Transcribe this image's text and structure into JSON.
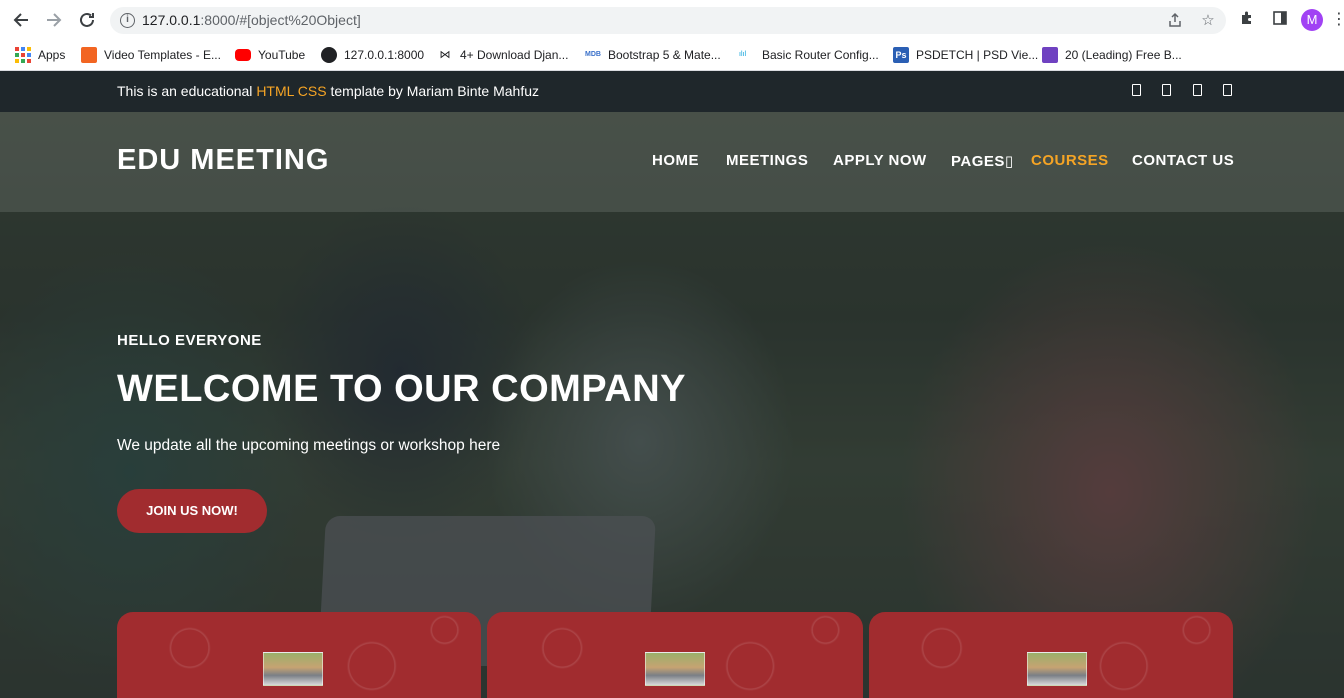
{
  "browser": {
    "url_host": "127.0.0.1",
    "url_rest": ":8000/#[object%20Object]",
    "profile_initial": "M",
    "bookmarks": [
      {
        "label": "Apps",
        "icon": "apps-grid-icon"
      },
      {
        "label": "Video Templates - E...",
        "icon": "f-logo-icon",
        "color": "#f26522"
      },
      {
        "label": "YouTube",
        "icon": "youtube-icon",
        "color": "#ff0000"
      },
      {
        "label": "127.0.0.1:8000",
        "icon": "globe-icon",
        "color": "#202124"
      },
      {
        "label": "4+ Download Djan...",
        "icon": "bowtie-icon",
        "color": "#202124"
      },
      {
        "label": "Bootstrap 5 & Mate...",
        "icon": "mdb-icon",
        "color": "#3b71ca"
      },
      {
        "label": "Basic Router Config...",
        "icon": "cisco-icon",
        "color": "#049fd9"
      },
      {
        "label": "PSDETCH | PSD Vie...",
        "icon": "ps-icon",
        "color": "#2b5fb4"
      },
      {
        "label": "20 (Leading) Free B...",
        "icon": "colorlib-icon",
        "color": "#6f42c1"
      }
    ]
  },
  "topbar": {
    "prefix": "This is an educational ",
    "accent": "HTML CSS",
    "suffix": " template by Mariam Binte Mahfuz",
    "social_icons": [
      "facebook-icon",
      "twitter-icon",
      "behance-icon",
      "dribbble-icon"
    ]
  },
  "header": {
    "logo": "EDU MEETING",
    "nav": [
      {
        "label": "HOME"
      },
      {
        "label": "MEETINGS"
      },
      {
        "label": "APPLY NOW"
      },
      {
        "label": "PAGES▯"
      },
      {
        "label": "COURSES",
        "active": true
      },
      {
        "label": "CONTACT US"
      }
    ]
  },
  "hero": {
    "hello": "HELLO EVERYONE",
    "title": "WELCOME TO OUR COMPANY",
    "subtitle": "We update all the upcoming meetings or workshop here",
    "cta": "JOIN US NOW!"
  },
  "colors": {
    "accent": "#f5a425",
    "brand_red": "#a12c2f",
    "topbar_bg": "#1f272b"
  }
}
